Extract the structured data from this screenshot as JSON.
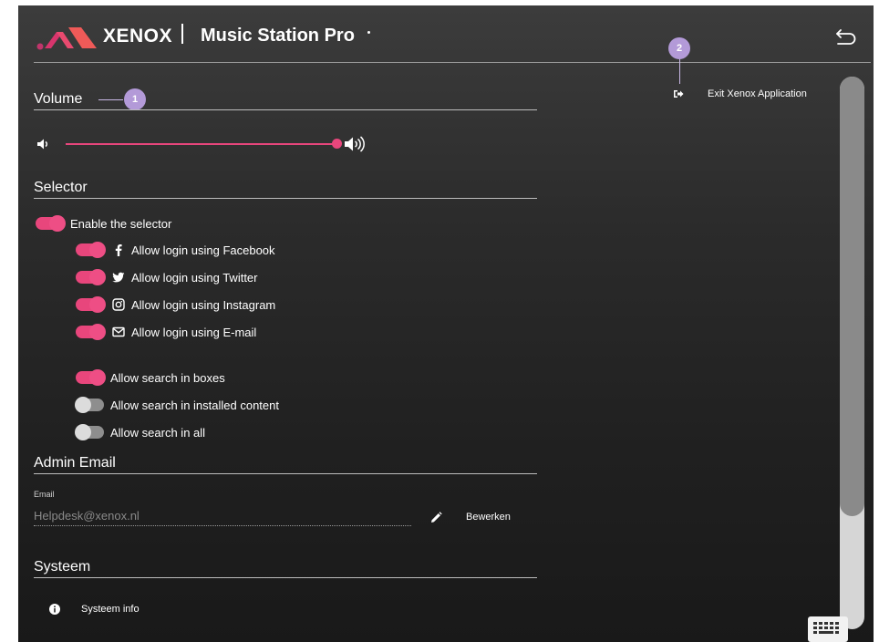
{
  "header": {
    "brand": "XENOX",
    "app_title": "Music Station Pro",
    "back_icon": "back-arrow-icon"
  },
  "callouts": [
    "1",
    "2"
  ],
  "exit": {
    "label": "Exit Xenox Application",
    "icon": "sign-out-icon"
  },
  "volume": {
    "title": "Volume",
    "level": 1.0,
    "icon_low": "volume-low-icon",
    "icon_high": "volume-high-icon"
  },
  "selector": {
    "title": "Selector",
    "enable": {
      "label": "Enable the selector",
      "on": true
    },
    "logins": [
      {
        "label": "Allow login using Facebook",
        "icon": "facebook-icon",
        "on": true
      },
      {
        "label": "Allow login using Twitter",
        "icon": "twitter-icon",
        "on": true
      },
      {
        "label": "Allow login using Instagram",
        "icon": "instagram-icon",
        "on": true
      },
      {
        "label": "Allow login using E-mail",
        "icon": "envelope-icon",
        "on": true
      }
    ],
    "search": [
      {
        "label": "Allow search in boxes",
        "on": true
      },
      {
        "label": "Allow search in installed content",
        "on": false
      },
      {
        "label": "Allow search in all",
        "on": false
      }
    ]
  },
  "admin_email": {
    "title": "Admin Email",
    "field_label": "Email",
    "placeholder": "Helpdesk@xenox.nl",
    "edit_label": "Bewerken"
  },
  "system": {
    "title": "Systeem",
    "info_label": "Systeem info"
  },
  "colors": {
    "accent": "#e8467c",
    "background": "#2a2a2a",
    "callout": "#b39ad8"
  }
}
